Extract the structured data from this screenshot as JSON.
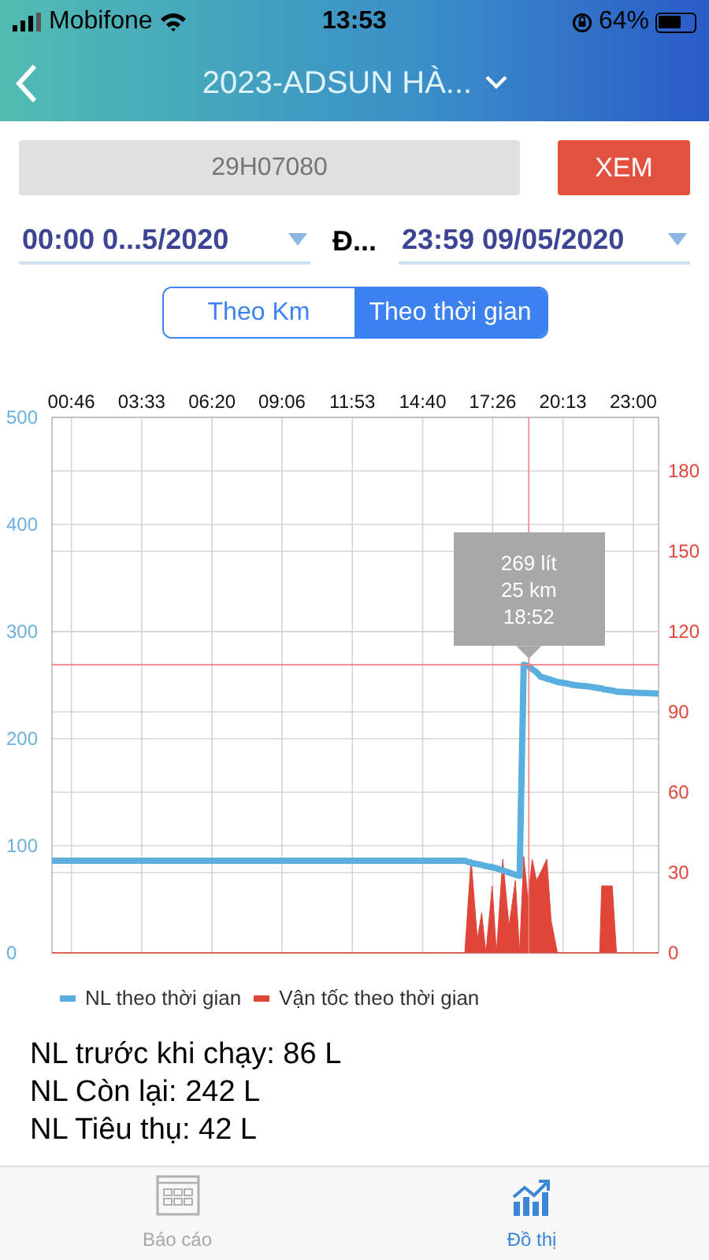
{
  "status_bar": {
    "carrier": "Mobifone",
    "time": "13:53",
    "battery": "64%"
  },
  "header": {
    "title": "2023-ADSUN HÀ..."
  },
  "plate_field": {
    "value": "29H07080"
  },
  "view_button": "XEM",
  "date_range": {
    "from": "00:00 0...5/2020",
    "separator": "Đ...",
    "to": "23:59 09/05/2020"
  },
  "mode_tabs": [
    {
      "label": "Theo Km",
      "selected": false
    },
    {
      "label": "Theo thời gian",
      "selected": true
    }
  ],
  "chart": {
    "tooltip": [
      "269 lít",
      "25 km",
      "18:52"
    ],
    "chart_data": {
      "type": "line",
      "grid": true,
      "xlim": [
        0,
        1440
      ],
      "ref_lines": [
        {
          "axis": "x",
          "value": 1132,
          "color": "#f08080"
        },
        {
          "axis": "y",
          "value": 269,
          "color": "#f08080"
        }
      ],
      "xticks": [
        {
          "value": 46,
          "label": "00:46"
        },
        {
          "value": 213,
          "label": "03:33"
        },
        {
          "value": 380,
          "label": "06:20"
        },
        {
          "value": 546,
          "label": "09:06"
        },
        {
          "value": 713,
          "label": "11:53"
        },
        {
          "value": 880,
          "label": "14:40"
        },
        {
          "value": 1046,
          "label": "17:26"
        },
        {
          "value": 1213,
          "label": "20:13"
        },
        {
          "value": 1380,
          "label": "23:00"
        }
      ],
      "ylim": [
        0,
        500
      ],
      "yticks": [
        0,
        100,
        200,
        300,
        400,
        500
      ],
      "y2lim": [
        0,
        200
      ],
      "y2ticks": [
        0,
        30,
        60,
        90,
        120,
        150,
        180
      ],
      "x": [
        0,
        980,
        995,
        1010,
        1020,
        1030,
        1045,
        1055,
        1070,
        1085,
        1100,
        1110,
        1120,
        1130,
        1140,
        1150,
        1160,
        1175,
        1185,
        1200,
        1215,
        1240,
        1270,
        1300,
        1305,
        1310,
        1330,
        1340,
        1380,
        1440
      ],
      "series": [
        {
          "name": "NL theo thời gian",
          "color": "#5aaee0",
          "values": [
            86,
            86,
            84,
            83,
            82,
            81,
            80,
            79,
            77,
            75,
            73,
            72,
            269,
            268,
            265,
            262,
            258,
            256,
            255,
            253,
            252,
            250,
            249,
            247,
            247,
            246,
            245,
            244,
            243,
            242
          ]
        },
        {
          "name": "Vận tốc theo thời gian",
          "color": "#e0453a",
          "type": "area",
          "axis": "y2",
          "values": [
            0,
            0,
            35,
            5,
            15,
            0,
            25,
            0,
            35,
            10,
            27,
            0,
            36,
            20,
            35,
            27,
            30,
            35,
            12,
            0,
            0,
            0,
            0,
            0,
            25,
            25,
            25,
            0,
            0,
            0
          ]
        }
      ]
    }
  },
  "summary": [
    "NL trước khi chạy: 86 L",
    "NL Còn lại: 242 L",
    "NL Tiêu thụ: 42 L"
  ],
  "bottom_tabs": [
    {
      "label": "Báo cáo",
      "kind": "report",
      "selected": false
    },
    {
      "label": "Đồ thị",
      "kind": "graph",
      "selected": true
    }
  ]
}
